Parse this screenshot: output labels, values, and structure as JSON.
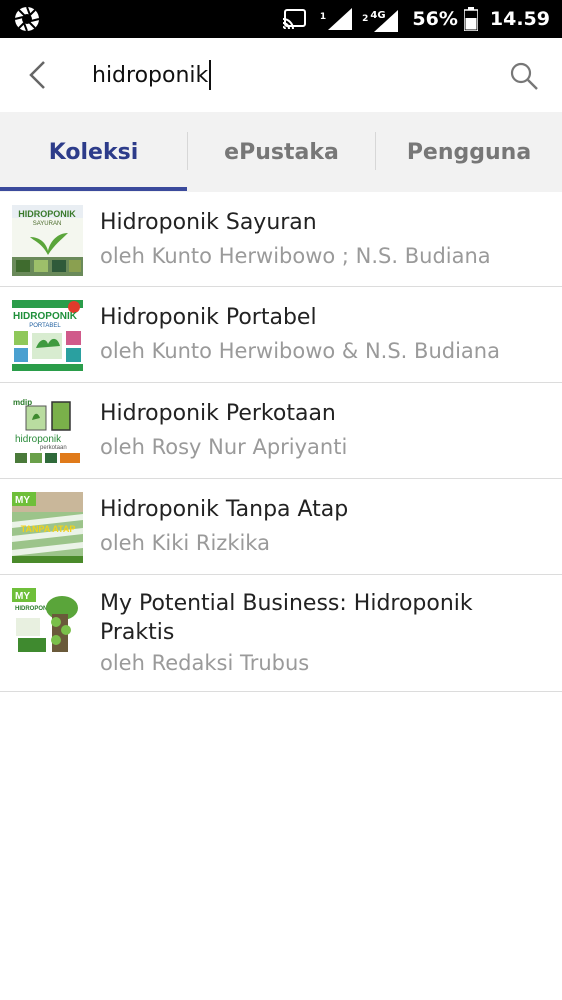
{
  "status_bar": {
    "sim1": "1",
    "sim2": "2",
    "network": "4G",
    "battery": "56%",
    "time": "14.59",
    "icons": [
      "aperture-app-icon",
      "cast-icon",
      "signal-icon",
      "signal-4g-icon",
      "battery-icon"
    ]
  },
  "search": {
    "query": "hidroponik",
    "back_icon": "back-arrow-icon",
    "search_icon": "search-icon"
  },
  "tabs": [
    {
      "label": "Koleksi",
      "active": true
    },
    {
      "label": "ePustaka",
      "active": false
    },
    {
      "label": "Pengguna",
      "active": false
    }
  ],
  "results": [
    {
      "title": "Hidroponik Sayuran",
      "author": "oleh Kunto Herwibowo  ; N.S. Budiana"
    },
    {
      "title": "Hidroponik Portabel",
      "author": "oleh Kunto Herwibowo & N.S. Budiana"
    },
    {
      "title": "Hidroponik Perkotaan",
      "author": "oleh Rosy Nur Apriyanti"
    },
    {
      "title": "Hidroponik Tanpa Atap",
      "author": "oleh Kiki Rizkika"
    },
    {
      "title": "My Potential Business: Hidroponik Praktis",
      "author": "oleh Redaksi Trubus"
    }
  ],
  "cover_text": {
    "c1": "HIDROPONIK",
    "c1_sub": "SAYURAN",
    "c2": "HIDROPONIK",
    "c2_sub": "PORTABEL",
    "c3_brand": "mdip",
    "c3": "hidroponik",
    "c3_sub": "perkotaan",
    "c4_brand": "MY",
    "c4": "TANPA ATAP",
    "c5_brand": "MY",
    "c5": "HIDROPONIK"
  },
  "colors": {
    "accent": "#3b4a9c",
    "tab_active": "#2d3c8a",
    "tab_inactive": "#777777",
    "author": "#9a9a9a"
  }
}
